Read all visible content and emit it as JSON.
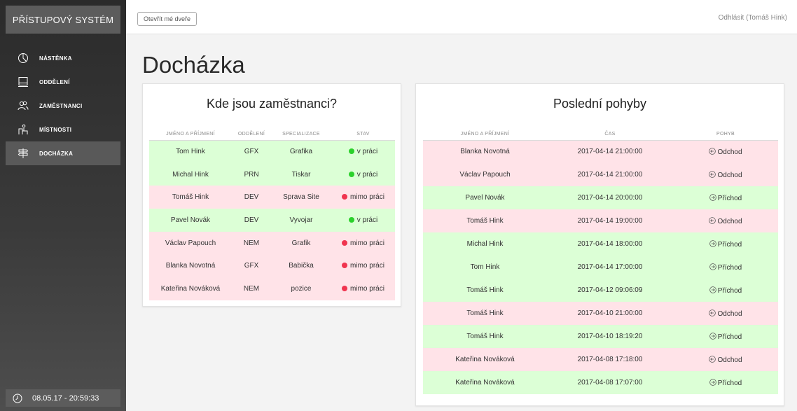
{
  "sidebar": {
    "brand": "PŘÍSTUPOVÝ SYSTÉM",
    "items": [
      {
        "label": "NÁSTĚNKA",
        "icon": "pie-chart-icon"
      },
      {
        "label": "ODDĚLENÍ",
        "icon": "monitor-icon"
      },
      {
        "label": "ZAMĚSTNANCI",
        "icon": "users-icon"
      },
      {
        "label": "MÍSTNOSTI",
        "icon": "rooms-icon"
      },
      {
        "label": "DOCHÁZKA",
        "icon": "signpost-icon",
        "active": true
      }
    ],
    "clock": "08.05.17 - 20:59:33"
  },
  "topbar": {
    "open_door": "Otevřít mé dveře",
    "logout": "Odhlásit (Tomáš Hink)"
  },
  "page_title": "Docházka",
  "colors": {
    "present_row": "#dcffd6",
    "absent_row": "#ffe3e8",
    "present_dot": "#2bd12b",
    "absent_dot": "#f0344f"
  },
  "employees": {
    "title": "Kde jsou zaměstnanci?",
    "headers": [
      "JMÉNO A PŘÍJMENÍ",
      "ODDĚLENÍ",
      "SPECIALIZACE",
      "STAV"
    ],
    "rows": [
      {
        "name": "Tom Hink",
        "dept": "GFX",
        "spec": "Grafika",
        "status": "v práci",
        "present": true
      },
      {
        "name": "Michal Hink",
        "dept": "PRN",
        "spec": "Tiskar",
        "status": "v práci",
        "present": true
      },
      {
        "name": "Tomáš Hink",
        "dept": "DEV",
        "spec": "Sprava Site",
        "status": "mimo práci",
        "present": false
      },
      {
        "name": "Pavel Novák",
        "dept": "DEV",
        "spec": "Vyvojar",
        "status": "v práci",
        "present": true
      },
      {
        "name": "Václav Papouch",
        "dept": "NEM",
        "spec": "Grafik",
        "status": "mimo práci",
        "present": false
      },
      {
        "name": "Blanka Novotná",
        "dept": "GFX",
        "spec": "Babička",
        "status": "mimo práci",
        "present": false
      },
      {
        "name": "Kateřina Nováková",
        "dept": "NEM",
        "spec": "pozice",
        "status": "mimo práci",
        "present": false
      }
    ]
  },
  "movements": {
    "title": "Poslední pohyby",
    "headers": [
      "JMÉNO A PŘÍJMENÍ",
      "ČAS",
      "POHYB"
    ],
    "rows": [
      {
        "name": "Blanka Novotná",
        "time": "2017-04-14 21:00:00",
        "move": "Odchod",
        "arrival": false
      },
      {
        "name": "Václav Papouch",
        "time": "2017-04-14 21:00:00",
        "move": "Odchod",
        "arrival": false
      },
      {
        "name": "Pavel Novák",
        "time": "2017-04-14 20:00:00",
        "move": "Příchod",
        "arrival": true
      },
      {
        "name": "Tomáš Hink",
        "time": "2017-04-14 19:00:00",
        "move": "Odchod",
        "arrival": false
      },
      {
        "name": "Michal Hink",
        "time": "2017-04-14 18:00:00",
        "move": "Příchod",
        "arrival": true
      },
      {
        "name": "Tom Hink",
        "time": "2017-04-14 17:00:00",
        "move": "Příchod",
        "arrival": true
      },
      {
        "name": "Tomáš Hink",
        "time": "2017-04-12 09:06:09",
        "move": "Příchod",
        "arrival": true
      },
      {
        "name": "Tomáš Hink",
        "time": "2017-04-10 21:00:00",
        "move": "Odchod",
        "arrival": false
      },
      {
        "name": "Tomáš Hink",
        "time": "2017-04-10 18:19:20",
        "move": "Příchod",
        "arrival": true
      },
      {
        "name": "Kateřina Nováková",
        "time": "2017-04-08 17:18:00",
        "move": "Odchod",
        "arrival": false
      },
      {
        "name": "Kateřina Nováková",
        "time": "2017-04-08 17:07:00",
        "move": "Příchod",
        "arrival": true
      }
    ]
  }
}
